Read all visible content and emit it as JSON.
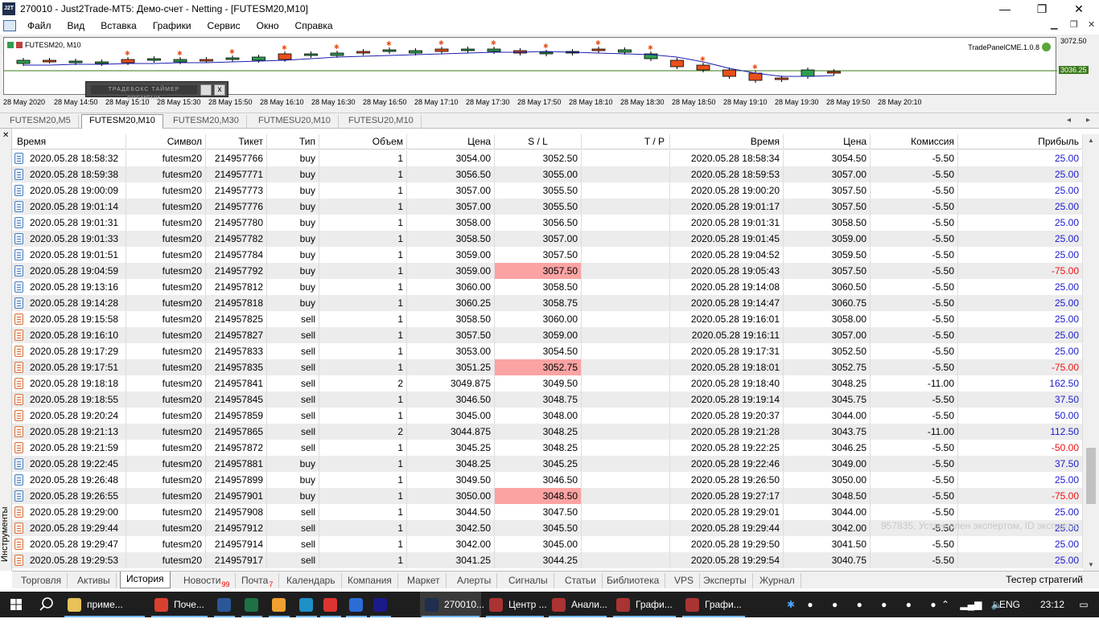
{
  "window": {
    "title": "270010 - Just2Trade-MT5: Демо-счет - Netting - [FUTESM20,M10]",
    "logo": "J2T",
    "minimize": "—",
    "maximize": "❐",
    "close": "✕"
  },
  "menu": [
    "Файл",
    "Вид",
    "Вставка",
    "Графики",
    "Сервис",
    "Окно",
    "Справка"
  ],
  "chart": {
    "symbol_label": "FUTESM20, M10",
    "panel_label": "TradePanelCME.1.0.8",
    "timer_label": "ТРАДЕБОКС ТАЙМЕР ВРЕМЕНИ",
    "timer_close": "x",
    "price_top": "3072.50",
    "price_current": "3036.25",
    "time_labels": [
      "28 May 2020",
      "28 May 14:50",
      "28 May 15:10",
      "28 May 15:30",
      "28 May 15:50",
      "28 May 16:10",
      "28 May 16:30",
      "28 May 16:50",
      "28 May 17:10",
      "28 May 17:30",
      "28 May 17:50",
      "28 May 18:10",
      "28 May 18:30",
      "28 May 18:50",
      "28 May 19:10",
      "28 May 19:30",
      "28 May 19:50",
      "28 May 20:10"
    ],
    "colors": {
      "bull": "#2e9e4f",
      "bear": "#e8501c",
      "ma": "#1f1fb0",
      "level": "#3a7a1a"
    }
  },
  "chart_tabs": [
    "FUTESM20,M5",
    "FUTESM20,M10",
    "FUTESM20,M30",
    "FUTMESU20,M10",
    "FUTESU20,M10"
  ],
  "chart_tabs_active": 1,
  "sidebar": {
    "close": "✕",
    "label": "Инструменты"
  },
  "columns": [
    "Время",
    "Символ",
    "Тикет",
    "Тип",
    "Объем",
    "Цена",
    "S / L",
    "T / P",
    "Время",
    "Цена",
    "Комиссия",
    "Прибыль"
  ],
  "rows": [
    {
      "time": "2020.05.28 18:58:32",
      "symbol": "futesm20",
      "ticket": "214957766",
      "type": "buy",
      "volume": "1",
      "price": "3054.00",
      "sl": "3052.50",
      "tp": "",
      "close_time": "2020.05.28 18:58:34",
      "close_price": "3054.50",
      "commission": "-5.50",
      "profit": "25.00"
    },
    {
      "time": "2020.05.28 18:59:38",
      "symbol": "futesm20",
      "ticket": "214957771",
      "type": "buy",
      "volume": "1",
      "price": "3056.50",
      "sl": "3055.00",
      "tp": "",
      "close_time": "2020.05.28 18:59:53",
      "close_price": "3057.00",
      "commission": "-5.50",
      "profit": "25.00"
    },
    {
      "time": "2020.05.28 19:00:09",
      "symbol": "futesm20",
      "ticket": "214957773",
      "type": "buy",
      "volume": "1",
      "price": "3057.00",
      "sl": "3055.50",
      "tp": "",
      "close_time": "2020.05.28 19:00:20",
      "close_price": "3057.50",
      "commission": "-5.50",
      "profit": "25.00"
    },
    {
      "time": "2020.05.28 19:01:14",
      "symbol": "futesm20",
      "ticket": "214957776",
      "type": "buy",
      "volume": "1",
      "price": "3057.00",
      "sl": "3055.50",
      "tp": "",
      "close_time": "2020.05.28 19:01:17",
      "close_price": "3057.50",
      "commission": "-5.50",
      "profit": "25.00"
    },
    {
      "time": "2020.05.28 19:01:31",
      "symbol": "futesm20",
      "ticket": "214957780",
      "type": "buy",
      "volume": "1",
      "price": "3058.00",
      "sl": "3056.50",
      "tp": "",
      "close_time": "2020.05.28 19:01:31",
      "close_price": "3058.50",
      "commission": "-5.50",
      "profit": "25.00"
    },
    {
      "time": "2020.05.28 19:01:33",
      "symbol": "futesm20",
      "ticket": "214957782",
      "type": "buy",
      "volume": "1",
      "price": "3058.50",
      "sl": "3057.00",
      "tp": "",
      "close_time": "2020.05.28 19:01:45",
      "close_price": "3059.00",
      "commission": "-5.50",
      "profit": "25.00"
    },
    {
      "time": "2020.05.28 19:01:51",
      "symbol": "futesm20",
      "ticket": "214957784",
      "type": "buy",
      "volume": "1",
      "price": "3059.00",
      "sl": "3057.50",
      "tp": "",
      "close_time": "2020.05.28 19:04:52",
      "close_price": "3059.50",
      "commission": "-5.50",
      "profit": "25.00"
    },
    {
      "time": "2020.05.28 19:04:59",
      "symbol": "futesm20",
      "ticket": "214957792",
      "type": "buy",
      "volume": "1",
      "price": "3059.00",
      "sl": "3057.50",
      "sl_hit": true,
      "tp": "",
      "close_time": "2020.05.28 19:05:43",
      "close_price": "3057.50",
      "commission": "-5.50",
      "profit": "-75.00"
    },
    {
      "time": "2020.05.28 19:13:16",
      "symbol": "futesm20",
      "ticket": "214957812",
      "type": "buy",
      "volume": "1",
      "price": "3060.00",
      "sl": "3058.50",
      "tp": "",
      "close_time": "2020.05.28 19:14:08",
      "close_price": "3060.50",
      "commission": "-5.50",
      "profit": "25.00"
    },
    {
      "time": "2020.05.28 19:14:28",
      "symbol": "futesm20",
      "ticket": "214957818",
      "type": "buy",
      "volume": "1",
      "price": "3060.25",
      "sl": "3058.75",
      "tp": "",
      "close_time": "2020.05.28 19:14:47",
      "close_price": "3060.75",
      "commission": "-5.50",
      "profit": "25.00"
    },
    {
      "time": "2020.05.28 19:15:58",
      "symbol": "futesm20",
      "ticket": "214957825",
      "type": "sell",
      "volume": "1",
      "price": "3058.50",
      "sl": "3060.00",
      "tp": "",
      "close_time": "2020.05.28 19:16:01",
      "close_price": "3058.00",
      "commission": "-5.50",
      "profit": "25.00"
    },
    {
      "time": "2020.05.28 19:16:10",
      "symbol": "futesm20",
      "ticket": "214957827",
      "type": "sell",
      "volume": "1",
      "price": "3057.50",
      "sl": "3059.00",
      "tp": "",
      "close_time": "2020.05.28 19:16:11",
      "close_price": "3057.00",
      "commission": "-5.50",
      "profit": "25.00"
    },
    {
      "time": "2020.05.28 19:17:29",
      "symbol": "futesm20",
      "ticket": "214957833",
      "type": "sell",
      "volume": "1",
      "price": "3053.00",
      "sl": "3054.50",
      "tp": "",
      "close_time": "2020.05.28 19:17:31",
      "close_price": "3052.50",
      "commission": "-5.50",
      "profit": "25.00"
    },
    {
      "time": "2020.05.28 19:17:51",
      "symbol": "futesm20",
      "ticket": "214957835",
      "type": "sell",
      "volume": "1",
      "price": "3051.25",
      "sl": "3052.75",
      "sl_hit": true,
      "tp": "",
      "close_time": "2020.05.28 19:18:01",
      "close_price": "3052.75",
      "commission": "-5.50",
      "profit": "-75.00"
    },
    {
      "time": "2020.05.28 19:18:18",
      "symbol": "futesm20",
      "ticket": "214957841",
      "type": "sell",
      "volume": "2",
      "price": "3049.875",
      "sl": "3049.50",
      "tp": "",
      "close_time": "2020.05.28 19:18:40",
      "close_price": "3048.25",
      "commission": "-11.00",
      "profit": "162.50"
    },
    {
      "time": "2020.05.28 19:18:55",
      "symbol": "futesm20",
      "ticket": "214957845",
      "type": "sell",
      "volume": "1",
      "price": "3046.50",
      "sl": "3048.75",
      "tp": "",
      "close_time": "2020.05.28 19:19:14",
      "close_price": "3045.75",
      "commission": "-5.50",
      "profit": "37.50"
    },
    {
      "time": "2020.05.28 19:20:24",
      "symbol": "futesm20",
      "ticket": "214957859",
      "type": "sell",
      "volume": "1",
      "price": "3045.00",
      "sl": "3048.00",
      "tp": "",
      "close_time": "2020.05.28 19:20:37",
      "close_price": "3044.00",
      "commission": "-5.50",
      "profit": "50.00"
    },
    {
      "time": "2020.05.28 19:21:13",
      "symbol": "futesm20",
      "ticket": "214957865",
      "type": "sell",
      "volume": "2",
      "price": "3044.875",
      "sl": "3048.25",
      "tp": "",
      "close_time": "2020.05.28 19:21:28",
      "close_price": "3043.75",
      "commission": "-11.00",
      "profit": "112.50"
    },
    {
      "time": "2020.05.28 19:21:59",
      "symbol": "futesm20",
      "ticket": "214957872",
      "type": "sell",
      "volume": "1",
      "price": "3045.25",
      "sl": "3048.25",
      "tp": "",
      "close_time": "2020.05.28 19:22:25",
      "close_price": "3046.25",
      "commission": "-5.50",
      "profit": "-50.00"
    },
    {
      "time": "2020.05.28 19:22:45",
      "symbol": "futesm20",
      "ticket": "214957881",
      "type": "buy",
      "volume": "1",
      "price": "3048.25",
      "sl": "3045.25",
      "tp": "",
      "close_time": "2020.05.28 19:22:46",
      "close_price": "3049.00",
      "commission": "-5.50",
      "profit": "37.50"
    },
    {
      "time": "2020.05.28 19:26:48",
      "symbol": "futesm20",
      "ticket": "214957899",
      "type": "buy",
      "volume": "1",
      "price": "3049.50",
      "sl": "3046.50",
      "tp": "",
      "close_time": "2020.05.28 19:26:50",
      "close_price": "3050.00",
      "commission": "-5.50",
      "profit": "25.00"
    },
    {
      "time": "2020.05.28 19:26:55",
      "symbol": "futesm20",
      "ticket": "214957901",
      "type": "buy",
      "volume": "1",
      "price": "3050.00",
      "sl": "3048.50",
      "sl_hit": true,
      "tp": "",
      "close_time": "2020.05.28 19:27:17",
      "close_price": "3048.50",
      "commission": "-5.50",
      "profit": "-75.00"
    },
    {
      "time": "2020.05.28 19:29:00",
      "symbol": "futesm20",
      "ticket": "214957908",
      "type": "sell",
      "volume": "1",
      "price": "3044.50",
      "sl": "3047.50",
      "tp": "",
      "close_time": "2020.05.28 19:29:01",
      "close_price": "3044.00",
      "commission": "-5.50",
      "profit": "25.00"
    },
    {
      "time": "2020.05.28 19:29:44",
      "symbol": "futesm20",
      "ticket": "214957912",
      "type": "sell",
      "volume": "1",
      "price": "3042.50",
      "sl": "3045.50",
      "tp": "",
      "close_time": "2020.05.28 19:29:44",
      "close_price": "3042.00",
      "commission": "-5.50",
      "profit": "25.00"
    },
    {
      "time": "2020.05.28 19:29:47",
      "symbol": "futesm20",
      "ticket": "214957914",
      "type": "sell",
      "volume": "1",
      "price": "3042.00",
      "sl": "3045.00",
      "tp": "",
      "close_time": "2020.05.28 19:29:50",
      "close_price": "3041.50",
      "commission": "-5.50",
      "profit": "25.00"
    },
    {
      "time": "2020.05.28 19:29:53",
      "symbol": "futesm20",
      "ticket": "214957917",
      "type": "sell",
      "volume": "1",
      "price": "3041.25",
      "sl": "3044.25",
      "tp": "",
      "close_time": "2020.05.28 19:29:54",
      "close_price": "3040.75",
      "commission": "-5.50",
      "profit": "25.00"
    }
  ],
  "tooltip": "957835, Установлен экспертом, ID эксперта: 23",
  "bottom_tabs": [
    {
      "label": "Торговля"
    },
    {
      "label": "Активы"
    },
    {
      "label": "История",
      "active": true
    },
    {
      "label": "Новости",
      "badge": "99"
    },
    {
      "label": "Почта",
      "badge": "7"
    },
    {
      "label": "Календарь"
    },
    {
      "label": "Компания"
    },
    {
      "label": "Маркет"
    },
    {
      "label": "Алерты"
    },
    {
      "label": "Сигналы"
    },
    {
      "label": "Статьи"
    },
    {
      "label": "Библиотека"
    },
    {
      "label": "VPS"
    },
    {
      "label": "Эксперты"
    },
    {
      "label": "Журнал"
    }
  ],
  "strategy_tester": "Тестер стратегий",
  "taskbar": {
    "items": [
      {
        "label": "приме...",
        "color": "#e8c15a"
      },
      {
        "label": "Поче...",
        "color": "#d9412f"
      },
      {
        "label": "",
        "color": "#2b5797"
      },
      {
        "label": "",
        "color": "#1e7145"
      },
      {
        "label": "",
        "color": "#f0a030"
      },
      {
        "label": "",
        "color": "#1e90c8"
      },
      {
        "label": "",
        "color": "#d33"
      },
      {
        "label": "",
        "color": "#2a6dd6"
      },
      {
        "label": "",
        "color": "#1a1a8a"
      },
      {
        "label": "270010...",
        "color": "#1f2f4d"
      },
      {
        "label": "Центр ...",
        "color": "#a33"
      },
      {
        "label": "Анали...",
        "color": "#a33"
      },
      {
        "label": "Графи...",
        "color": "#a33"
      },
      {
        "label": "Графи...",
        "color": "#a33"
      }
    ],
    "lang": "ENG",
    "clock": "23:12"
  }
}
